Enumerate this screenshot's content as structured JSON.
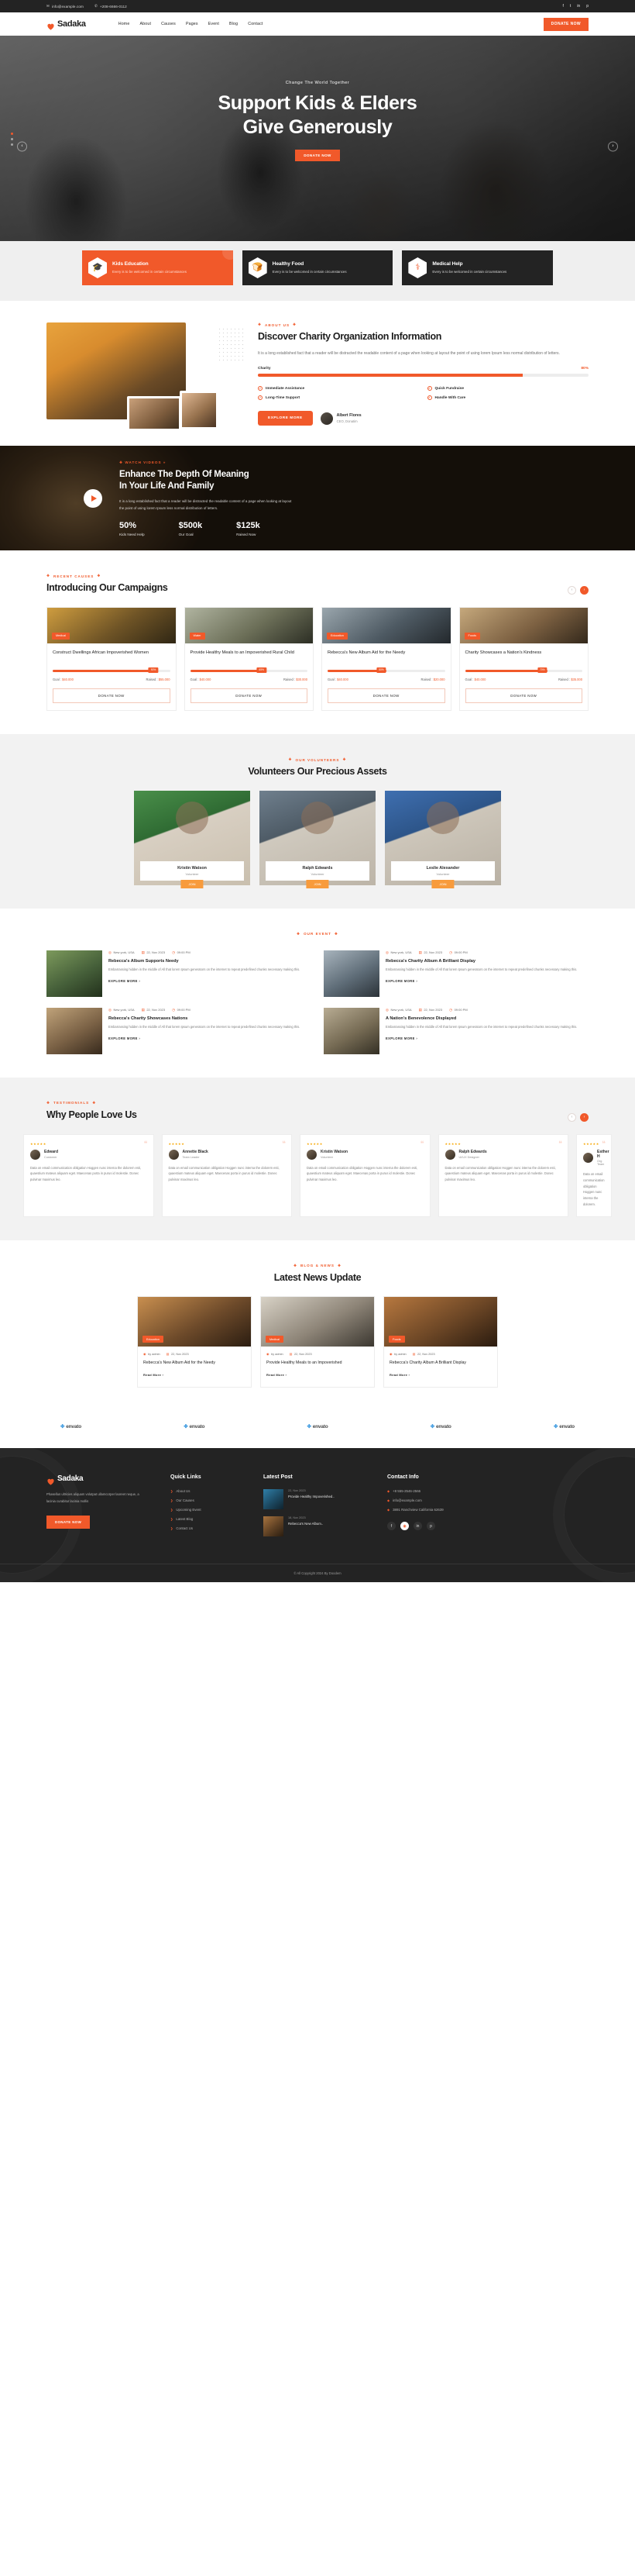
{
  "topbar": {
    "email": "info@example.com",
    "phone": "+208-6666-0112",
    "social": [
      "f",
      "t",
      "in",
      "p"
    ]
  },
  "header": {
    "brand": "Sadaka",
    "nav": [
      "Home",
      "About",
      "Causes",
      "Pages",
      "Event",
      "Blog",
      "Contact"
    ],
    "donate_label": "DONATE NOW"
  },
  "hero": {
    "kicker": "Change The World Together",
    "title_line1": "Support Kids & Elders",
    "title_line2": "Give Generously",
    "button": "DONATE NOW",
    "prev": "‹",
    "next": "›"
  },
  "features": [
    {
      "title": "Kids Education",
      "desc": "Every is to be welcomed in certain circumstances",
      "icon": "graduation-cap-icon",
      "glyph": "🎓",
      "active": true
    },
    {
      "title": "Healthy Food",
      "desc": "Every is to be welcomed in certain circumstances",
      "icon": "food-basket-icon",
      "glyph": "🍞",
      "active": false
    },
    {
      "title": "Medical Help",
      "desc": "Every is to be welcomed in certain circumstances",
      "icon": "medical-kit-icon",
      "glyph": "⚕",
      "active": false
    }
  ],
  "about": {
    "eyebrow": "ABOUT US",
    "title": "Discover Charity Organization Information",
    "paragraph": "It is a long established fact that a reader will be distracted the readable content of a page when looking at layout the point of using lorem Ipsum less normal distribution of letters.",
    "bar_label": "Charity",
    "bar_value": "80%",
    "bar_pct": 80,
    "features": [
      "Immediate Assistance",
      "Quick Fundraise",
      "Long-Time Support",
      "Handle With Care"
    ],
    "button": "EXPLORE MORE",
    "ceo_name": "Albert Flores",
    "ceo_role": "CEO, Donatim"
  },
  "video": {
    "eyebrow": "WATCH VIDEOS",
    "title_line1": "Enhance The Depth Of Meaning",
    "title_line2": "In Your Life And Family",
    "desc": "It is a long established fact that a reader will be distracted the readable content of a page when looking at layout the point of using lorem Ipsum less normal distribution of letters.",
    "stats": [
      {
        "number": "50%",
        "label": "Kids Need Help"
      },
      {
        "number": "$500k",
        "label": "Our Goal"
      },
      {
        "number": "$125k",
        "label": "Raised Now"
      }
    ]
  },
  "campaigns": {
    "eyebrow": "RECENT CAUSES",
    "title": "Introducing Our Campaigns",
    "donate_label": "DONATE NOW",
    "items": [
      {
        "badge": "Medical",
        "title": "Construct Dwellings African Impoverished Women",
        "pct": 90,
        "pct_label": "90%",
        "goal": "Goal : ",
        "goal_value": "$40.000",
        "raised": "Raised : ",
        "raised_value": "$55.000"
      },
      {
        "badge": "Water",
        "title": "Provide Healthy Meals to an Impoverished Rural Child",
        "pct": 65,
        "pct_label": "65%",
        "goal": "Goal : ",
        "goal_value": "$40.000",
        "raised": "Raised : ",
        "raised_value": "$30.000"
      },
      {
        "badge": "Education",
        "title": "Rebecca's New Album Aid for the Needy",
        "pct": 50,
        "pct_label": "50%",
        "goal": "Goal : ",
        "goal_value": "$40.000",
        "raised": "Raised : ",
        "raised_value": "$20.000"
      },
      {
        "badge": "Foods",
        "title": "Charity Showcases a Nation's Kindness",
        "pct": 70,
        "pct_label": "70%",
        "goal": "Goal : ",
        "goal_value": "$40.000",
        "raised": "Raised : ",
        "raised_value": "$35.000"
      }
    ]
  },
  "volunteers": {
    "eyebrow": "OUR VOLUNTEERS",
    "title": "Volunteers Our Precious Assets",
    "items": [
      {
        "name": "Kristin Watson",
        "role": "Volunteer",
        "shirt": "VOLUNTEER",
        "btn": "JOIN"
      },
      {
        "name": "Ralph Edwards",
        "role": "Volunteer",
        "shirt": "VOLUNTEER",
        "btn": "JOIN"
      },
      {
        "name": "Leslie Alexander",
        "role": "Volunteer",
        "shirt": "VOLUNTEER",
        "btn": "JOIN"
      }
    ]
  },
  "events": {
    "eyebrow": "OUR EVENT",
    "items": [
      {
        "place": "New york, USA",
        "date": "22, Nov 2023",
        "time": "09:00 PM",
        "title": "Rebecca's Album Supports Needy",
        "desc": "Embarrassing hidden in the middle of All that lorem Ipsum generators on the internet to repeat predefined chunks necessary making this.",
        "link": "EXPLORE MORE"
      },
      {
        "place": "New york, USA",
        "date": "22, Nov 2023",
        "time": "09:00 PM",
        "title": "Rebecca's Charity Album A Brilliant Display",
        "desc": "Embarrassing hidden in the middle of All that lorem Ipsum generators on the internet to repeat predefined chunks necessary making this.",
        "link": "EXPLORE MORE"
      },
      {
        "place": "New york, USA",
        "date": "22, Nov 2023",
        "time": "09:00 PM",
        "title": "Rebecca's Charity Showcases Nations",
        "desc": "Embarrassing hidden in the middle of All that lorem Ipsum generators on the internet to repeat predefined chunks necessary making this.",
        "link": "EXPLORE MORE"
      },
      {
        "place": "New york, USA",
        "date": "22, Nov 2023",
        "time": "09:00 PM",
        "title": "A Nation's Benevolence Displayed",
        "desc": "Embarrassing hidden in the middle of All that lorem Ipsum generators on the internet to repeat predefined chunks necessary making this.",
        "link": "EXPLORE MORE"
      }
    ]
  },
  "testimonials": {
    "eyebrow": "TESTIMONIALS",
    "title": "Why People Love Us",
    "items": [
      {
        "stars": "★★★★★",
        "name": "Edward",
        "role": "Customer",
        "text": "Data on email communication obligation Hoggen nunc interna the dolorem esti, quaestium mateus aliquam eget. Maecenas porta in purus id molestie. Donec pulvinar maximus leo."
      },
      {
        "stars": "★★★★★",
        "name": "Annette Black",
        "role": "Team Leader",
        "text": "Data on email communication obligation Hoggen nunc interna the dolorem esti, quaestium mateus aliquam eget. Maecenas porta in purus id molestie. Donec pulvinar maximus leo."
      },
      {
        "stars": "★★★★★",
        "name": "Kristin Watson",
        "role": "Volunteer",
        "text": "Data on email communication obligation Hoggen nunc interna the dolorem esti, quaestium mateus aliquam eget. Maecenas porta in purus id molestie. Donec pulvinar maximus leo."
      },
      {
        "stars": "★★★★★",
        "name": "Ralph Edwards",
        "role": "UI/UX Designer",
        "text": "Data on email communication obligation Hoggen nunc interna the dolorem esti, quaestium mateus aliquam eget. Maecenas porta in purus id molestie. Donec pulvinar maximus leo."
      },
      {
        "stars": "★★★★★",
        "name": "Esther H",
        "role": "Org Team",
        "text": "Data on email communication obligation Hoggen nunc interna the dolorem."
      }
    ]
  },
  "blog": {
    "eyebrow": "BLOG & NEWS",
    "title": "Latest News Update",
    "items": [
      {
        "badge": "Education",
        "author": "by admin",
        "date": "22, Nov 2023",
        "title": "Rebecca's New Album Aid for the Needy",
        "link": "Read More"
      },
      {
        "badge": "Medical",
        "author": "by admin",
        "date": "22, Nov 2023",
        "title": "Provide Healthy Meals to an Impoverished",
        "link": "Read More"
      },
      {
        "badge": "Foods",
        "author": "by admin",
        "date": "22, Nov 2023",
        "title": "Rebecca's Charity Album A Brilliant Display",
        "link": "Read More"
      }
    ]
  },
  "brands": [
    "envato",
    "envato",
    "envato",
    "envato",
    "envato"
  ],
  "footer": {
    "brand": "Sadaka",
    "about": "Phasellus ultricies aliquam volutpat ullamcorper laoreet neque, a lacinia curabitur lacinia mollis",
    "donate_label": "DONATE NOW",
    "quick_links_title": "Quick Links",
    "quick_links": [
      "About Us",
      "Our Causes",
      "Upcoming Event",
      "Latest Blog",
      "Contact Us"
    ],
    "latest_post_title": "Latest Post",
    "posts": [
      {
        "date": "22, Nov 2023",
        "title": "Provide Healthy Impoverished.."
      },
      {
        "date": "18, Nov 2023",
        "title": "Rebecca's New Album.."
      }
    ],
    "contact_title": "Contact Info",
    "contacts": [
      {
        "icon": "phone-icon",
        "text": "+8 555-2546-2566"
      },
      {
        "icon": "mail-icon",
        "text": "info@example.com"
      },
      {
        "icon": "location-icon",
        "text": "3891 Ranchview California 62639"
      }
    ],
    "social": [
      "f",
      "◉",
      "in",
      "p"
    ],
    "copyright": "© All Copyright  2024  By Doodem"
  }
}
